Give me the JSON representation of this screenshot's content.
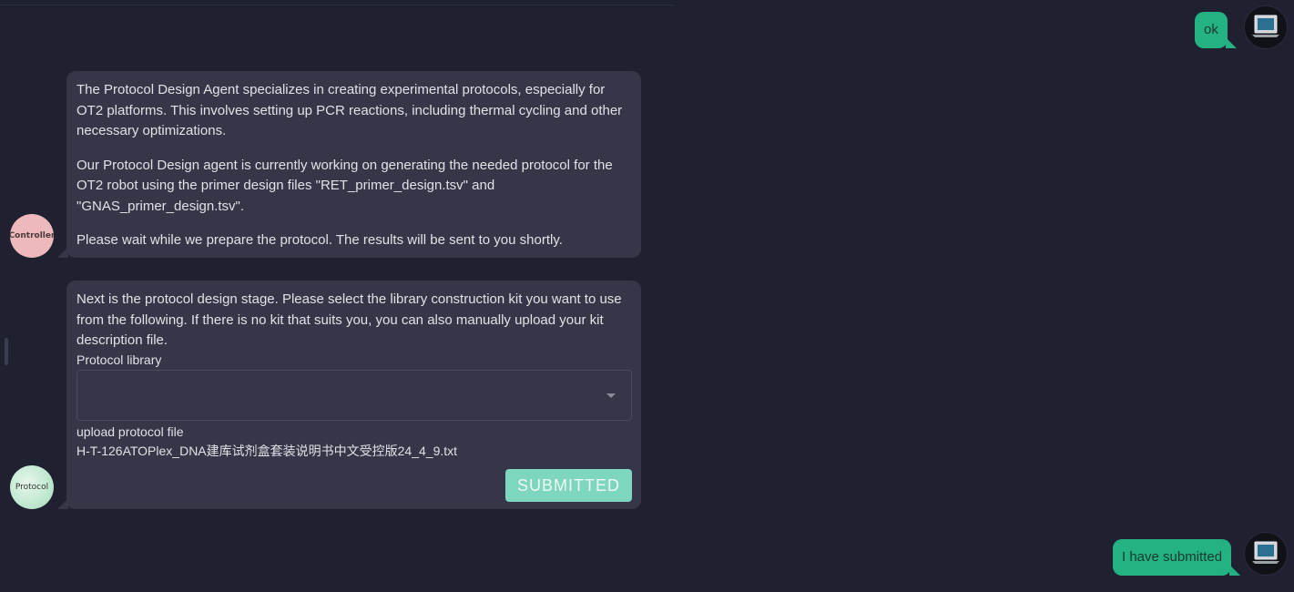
{
  "messages": {
    "user_msg_1": {
      "text": "ok"
    },
    "controller_msg": {
      "avatar_label": "Controller",
      "paragraphs": [
        "The Protocol Design Agent specializes in creating experimental protocols, especially for OT2 platforms. This involves setting up PCR reactions, including thermal cycling and other necessary optimizations.",
        "Our Protocol Design agent is currently working on generating the needed protocol for the OT2 robot using the primer design files \"RET_primer_design.tsv\" and \"GNAS_primer_design.tsv\".",
        "Please wait while we prepare the protocol. The results will be sent to you shortly."
      ]
    },
    "protocol_msg": {
      "avatar_label": "Protocol",
      "intro": "Next is the protocol design stage. Please select the library construction kit you want to use from the following. If there is no kit that suits you, you can also manually upload your kit description file.",
      "library_label": "Protocol library",
      "library_value": "",
      "upload_label": "upload protocol file",
      "uploaded_file": "H-T-126ATOPlex_DNA建库试剂盒套装说明书中文受控版24_4_9.txt",
      "submit_label": "SUBMITTED"
    },
    "user_msg_2": {
      "text": "I have submitted"
    }
  },
  "colors": {
    "background": "#1f2030",
    "bot_bubble": "#353647",
    "user_bubble": "#25b283",
    "submit_button": "#7ed6be"
  }
}
